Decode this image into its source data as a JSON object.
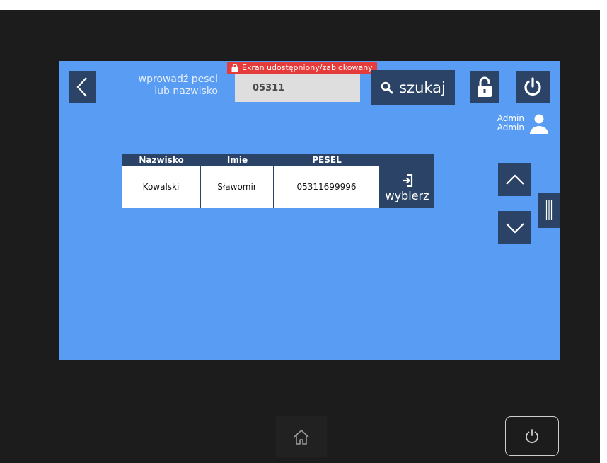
{
  "header": {
    "prompt_line1": "wprowadź pesel",
    "prompt_line2": "lub nazwisko",
    "search_value": "05311",
    "locked_badge": "Ekran udostępniony/zablokowany",
    "search_label": "szukaj"
  },
  "user": {
    "first": "Admin",
    "last": "Admin"
  },
  "results": {
    "columns": [
      "Nazwisko",
      "Imie",
      "PESEL"
    ],
    "rows": [
      {
        "surname": "Kowalski",
        "name": "Sławomir",
        "pesel": "05311699996"
      }
    ],
    "select_label": "wybierz"
  },
  "colors": {
    "screen": "#589cf4",
    "button": "#2a4366",
    "badge": "#e53b3b"
  },
  "icons": [
    "back-icon",
    "lock-icon",
    "search-icon",
    "unlock-icon",
    "power-icon",
    "user-icon",
    "login-icon",
    "chevron-up-icon",
    "chevron-down-icon",
    "grip-icon",
    "home-icon"
  ]
}
